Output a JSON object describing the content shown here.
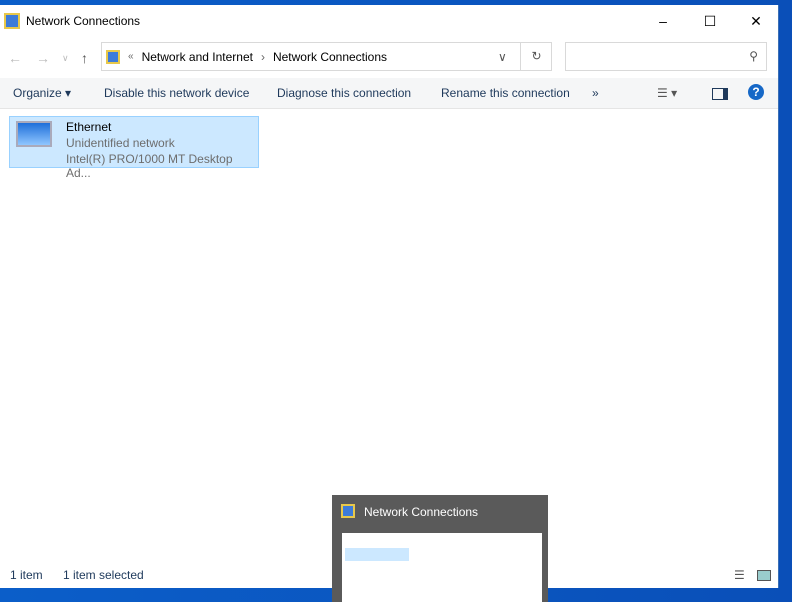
{
  "window": {
    "title": "Network Connections"
  },
  "address": {
    "crumbs": [
      "Network and Internet",
      "Network Connections"
    ],
    "search_placeholder": ""
  },
  "toolbar": {
    "organize": "Organize",
    "disable": "Disable this network device",
    "diagnose": "Diagnose this connection",
    "rename": "Rename this connection",
    "more": "»"
  },
  "items": [
    {
      "name": "Ethernet",
      "status": "Unidentified network",
      "device": "Intel(R) PRO/1000 MT Desktop Ad..."
    }
  ],
  "statusbar": {
    "count": "1 item",
    "selected": "1 item selected"
  },
  "taskbar_preview": {
    "title": "Network Connections"
  }
}
